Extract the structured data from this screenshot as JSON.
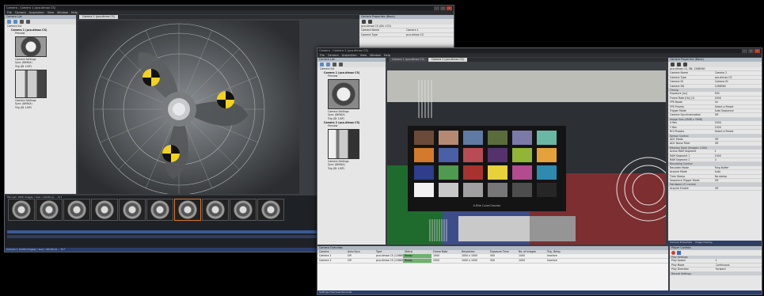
{
  "win1": {
    "title": "Camera - Camera 1 (pco.dimax CS)",
    "menu": [
      "File",
      "Camera",
      "Acquisition",
      "View",
      "Window",
      "Help"
    ],
    "tab_active": "Camera 1 (pco.dimax CS)",
    "camera_list_header": "Camera List",
    "tree": {
      "root": "Camera list",
      "camera1": "Camera 1 (pco.dimax CS)",
      "preview": "Preview",
      "camera_settings": "Camera Settings",
      "sync": "Sync (DIMAX)",
      "trig": "Trig (DI 1.BP)"
    },
    "props_header": "Camera Properties (Basic)",
    "props": [
      {
        "k": "pco.dimax CS (SN: 123)",
        "v": ""
      },
      {
        "k": "Camera Name",
        "v": "Camera 1"
      },
      {
        "k": "Camera Type",
        "v": "pco.dimax CS"
      }
    ],
    "strip_caption": "Pts Cam 1000 Images / 1sec / 40x40 px ... 8.7",
    "status": "Camera 1 (1000 Images) / 1sec / 40x40 px ... 8.7"
  },
  "win2": {
    "title": "Camera - Camera 2 (pco.dimax CS)",
    "menu": [
      "File",
      "Camera",
      "Acquisition",
      "View",
      "Window",
      "Help"
    ],
    "tabs": [
      "Camera 1 (pco.dimax CS)",
      "Camera 2 (pco.dimax CS)"
    ],
    "camera_list_header": "Camera List",
    "tree": {
      "root": "Camera list",
      "camera1": "Camera 1 (pco.dimax CS)",
      "preview": "Preview",
      "camera_settings": "Camera Settings",
      "sync": "Sync (DIMAX)",
      "trig": "Trig (DI 1.BP)",
      "camera2": "Camera 2 (pco.dimax CS)"
    },
    "props_header": "Camera Properties (Basic)",
    "props": [
      {
        "k": "pco.dimax CS, SN: 1268560",
        "v": ""
      },
      {
        "k": "Camera Name",
        "v": "Camera 2"
      },
      {
        "k": "Camera Type",
        "v": "pco.dimax CS"
      },
      {
        "k": "Camera ID",
        "v": "Camera ID"
      },
      {
        "k": "Camera SN",
        "v": "1268560"
      }
    ],
    "props_sections": [
      "Timing",
      "Image Size (XMIN x YMIN)",
      "Sensor Control",
      "Memory Save (Images: 1000)",
      "Recording Control",
      "Hardware I/O control"
    ],
    "props_more": [
      {
        "k": "Exposure [us]",
        "v": "500"
      },
      {
        "k": "Frame Rate [Hz] (1)",
        "v": "2000"
      },
      {
        "k": "FPS Boost",
        "v": "On"
      },
      {
        "k": "FPS Priority",
        "v": "Select a Preset"
      },
      {
        "k": "Trigger Mode",
        "v": "Auto Sequence"
      },
      {
        "k": "Camera Synchronization",
        "v": "Off"
      },
      {
        "k": "X Res",
        "v": "2000"
      },
      {
        "k": "Y Res",
        "v": "1000"
      },
      {
        "k": "ROI Presets",
        "v": "Select a Preset"
      },
      {
        "k": "ADC Mode",
        "v": "Off"
      },
      {
        "k": "ADC Noise Filter",
        "v": "Off"
      },
      {
        "k": "Active RAM Segment",
        "v": "1"
      },
      {
        "k": "RAM Segment 1",
        "v": "1000"
      },
      {
        "k": "RAM Segment 2",
        "v": "0"
      },
      {
        "k": "Recorder Mode",
        "v": "Ring Buffer"
      },
      {
        "k": "Acquire Mode",
        "v": "Auto"
      },
      {
        "k": "Time Stamp",
        "v": "No stamp"
      },
      {
        "k": "Sequence Trigger Mode",
        "v": "Off"
      },
      {
        "k": "Acquire Enable",
        "v": "Off"
      }
    ],
    "prop_tabs": [
      "Camera Properties",
      "Image Overlay"
    ],
    "grid_header": "Camera Overview",
    "grid_cols": [
      "Camera",
      "Auto Sync",
      "Type",
      "Status",
      "Frame Rate",
      "Resolution",
      "Exposure Time",
      "No. of Images",
      "Trig. Delay"
    ],
    "grid_rows": [
      [
        "Camera 1",
        "Off",
        "pco.dimax CS (1268001)",
        "Ready",
        "1000",
        "1000 x 1000",
        "500",
        "1000",
        "Inactive"
      ],
      [
        "Camera 2",
        "Off",
        "pco.dimax CS (1268560)",
        "Ready",
        "2000",
        "1000 x 1000",
        "500",
        "1000",
        "Inactive"
      ]
    ],
    "playback_header": "Player Controls",
    "playback": [
      {
        "k": "Play Settings",
        "v": ""
      },
      {
        "k": "Play Speed",
        "v": "1"
      },
      {
        "k": "Play Mode",
        "v": "Continuous"
      },
      {
        "k": "Play Direction",
        "v": "Forward"
      },
      {
        "k": "Record Settings",
        "v": ""
      }
    ],
    "status": "Settings Overview   Recorder"
  },
  "chart_colors": [
    "#6b4a3a",
    "#b58a73",
    "#5f7aa3",
    "#5a6c3c",
    "#7c7aa8",
    "#69b8a6",
    "#d37a2e",
    "#4a5fa5",
    "#b94b55",
    "#55326e",
    "#93b535",
    "#e6a23a",
    "#2e3d8c",
    "#4f9a4f",
    "#a8322f",
    "#e7d23b",
    "#b24c8f",
    "#2f8ab0",
    "#f2f2f2",
    "#c8c8c8",
    "#a0a0a0",
    "#777777",
    "#4d4d4d",
    "#262626"
  ]
}
